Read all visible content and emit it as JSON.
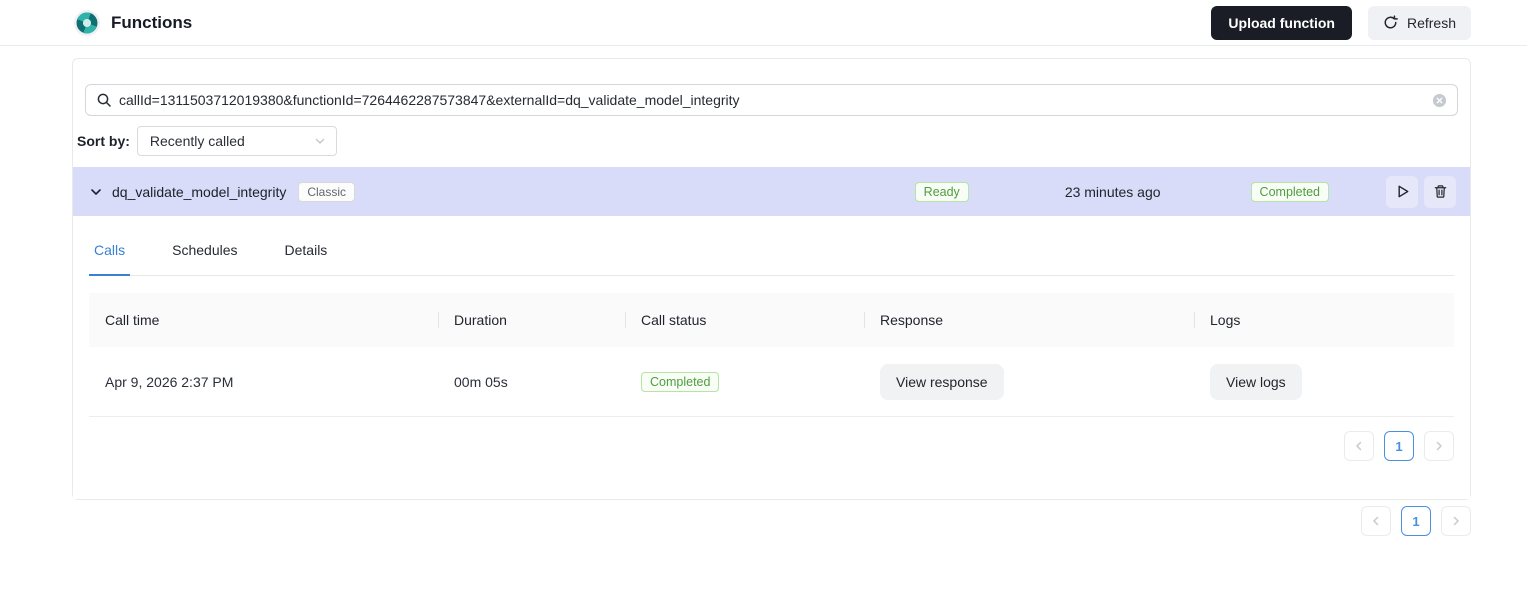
{
  "colors": {
    "panel_header_bg": "#d8dcf8",
    "accent_blue": "#3b80d1",
    "pagination_blue": "#4a90e2",
    "badge_green_text": "#4e9d3f",
    "badge_green_border": "#b6e3a6",
    "badge_green_bg": "#f8fef5",
    "dark_button_bg": "#1a1d26"
  },
  "header": {
    "title": "Functions",
    "upload_button": "Upload function",
    "refresh_button": "Refresh"
  },
  "search": {
    "value": "callId=1311503712019380&functionId=7264462287573847&externalId=dq_validate_model_integrity"
  },
  "sort": {
    "label": "Sort by:",
    "selected": "Recently called"
  },
  "function_panel": {
    "name": "dq_validate_model_integrity",
    "type_badge": "Classic",
    "status": "Ready",
    "last_called": "23 minutes ago",
    "last_call_status": "Completed"
  },
  "tabs": [
    {
      "label": "Calls",
      "active": true
    },
    {
      "label": "Schedules",
      "active": false
    },
    {
      "label": "Details",
      "active": false
    }
  ],
  "calls_table": {
    "columns": [
      "Call time",
      "Duration",
      "Call status",
      "Response",
      "Logs"
    ],
    "rows": [
      {
        "call_time": "Apr 9, 2026 2:37 PM",
        "duration": "00m 05s",
        "status": "Completed",
        "response_action": "View response",
        "logs_action": "View logs"
      }
    ]
  },
  "panel_pagination": {
    "page": "1"
  },
  "page_pagination": {
    "page": "1"
  }
}
